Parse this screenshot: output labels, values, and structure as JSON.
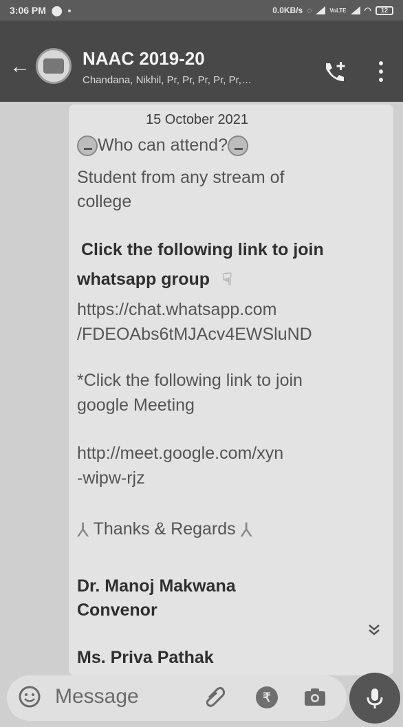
{
  "status_bar": {
    "time": "3:06 PM",
    "network_speed": "0.0KB/s",
    "network_type": "VoLTE",
    "battery": "12"
  },
  "header": {
    "title": "NAAC 2019-20",
    "subtitle": "Chandana, Nikhil, Pr, Pr, Pr, Pr, Pr,…"
  },
  "message": {
    "date": "15 October 2021",
    "lines": {
      "who_can_attend": "Who can attend?",
      "audience_1": "Student from any stream of",
      "audience_2": "college",
      "wa_heading_1": "Click the following link to join",
      "wa_heading_2": "whatsapp group",
      "wa_link_1": "https://chat.whatsapp.com",
      "wa_link_2": "/FDEOAbs6tMJAcv4EWSluND",
      "meet_heading_1": "*Click the following link to join",
      "meet_heading_2": "google Meeting",
      "meet_link_1": "http://meet.google.com/xyn",
      "meet_link_2": "-wipw-rjz",
      "thanks": "Thanks & Regards",
      "signatory_1_name": "Dr. Manoj Makwana",
      "signatory_1_role": "Convenor",
      "signatory_2_name": "Ms. Priva Pathak"
    }
  },
  "composer": {
    "placeholder": "Message"
  },
  "icons": {
    "back": "arrow-left",
    "call_add": "add-call",
    "menu": "more-vertical",
    "emoji": "thinking-face",
    "pray": "folded-hands",
    "point": "pointing-hand",
    "scroll": "double-chevron-down",
    "smiley": "smiley",
    "attach": "paperclip",
    "payment": "rupee",
    "camera": "camera",
    "mic": "microphone"
  }
}
